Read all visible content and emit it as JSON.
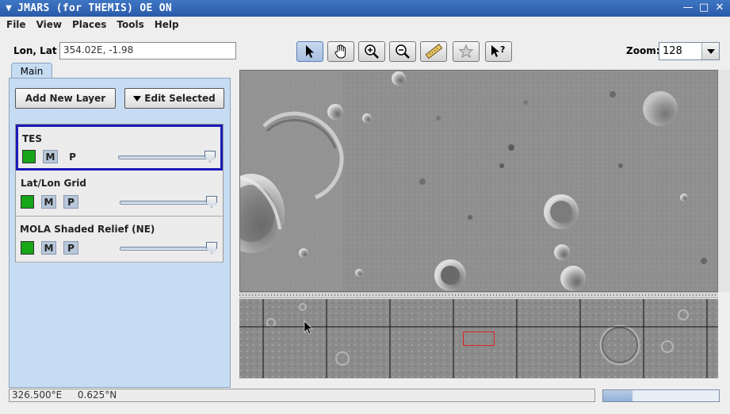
{
  "window": {
    "title": "JMARS (for THEMIS) OE ON",
    "controls": [
      "minimize",
      "maximize",
      "close"
    ]
  },
  "menu": [
    {
      "label": "File"
    },
    {
      "label": "View"
    },
    {
      "label": "Places"
    },
    {
      "label": "Tools"
    },
    {
      "label": "Help"
    }
  ],
  "toolbar": {
    "lonlat_label": "Lon, Lat",
    "lonlat_value": "354.02E, -1.98",
    "tools": [
      "pointer-icon",
      "pan-hand-icon",
      "zoom-in-icon",
      "zoom-out-icon",
      "ruler-icon",
      "star-icon",
      "whats-this-icon"
    ],
    "zoom_label": "Zoom:",
    "zoom_value": "128"
  },
  "panel": {
    "tab_label": "Main",
    "add_layer_label": "Add New Layer",
    "edit_selected_label": "Edit Selected",
    "layers": [
      {
        "name": "TES",
        "m": "M",
        "p": "P",
        "color": "#17a617",
        "opacity": 1.0,
        "selected": true
      },
      {
        "name": "Lat/Lon Grid",
        "m": "M",
        "p": "P",
        "color": "#17a617",
        "opacity": 1.0,
        "selected": false
      },
      {
        "name": "MOLA Shaded Relief (NE)",
        "m": "M",
        "p": "P",
        "color": "#17a617",
        "opacity": 1.0,
        "selected": false
      }
    ]
  },
  "status": {
    "lon": "326.500°E",
    "lat": "0.625°N",
    "progress": 0.25
  },
  "colors": {
    "title_bar": "#2a5aa8",
    "panel_bg": "#c6dcf2",
    "selection_border": "#1a1ab8",
    "layer_swatch": "#17a617",
    "overview_box": "#e02020"
  }
}
